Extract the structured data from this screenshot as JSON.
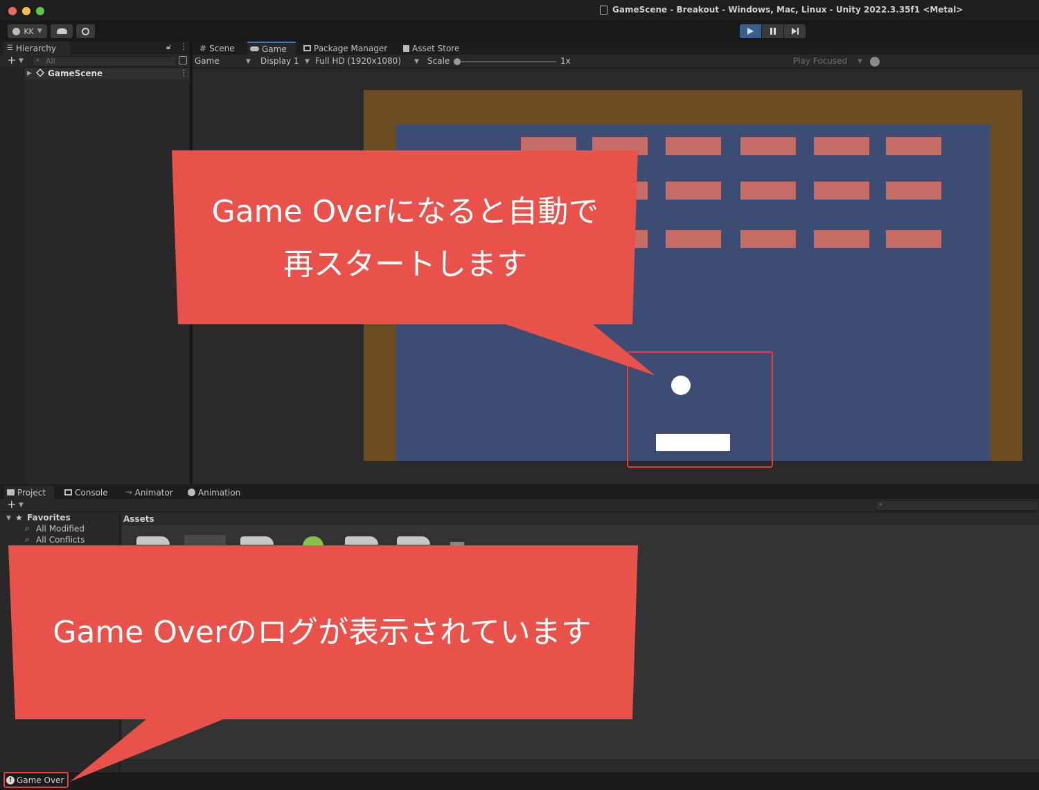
{
  "window": {
    "title": "GameScene - Breakout - Windows, Mac, Linux - Unity 2022.3.35f1 <Metal>"
  },
  "toolbar": {
    "account_label": "KK"
  },
  "hierarchy": {
    "tab_label": "Hierarchy",
    "search_placeholder": "All",
    "scene_name": "GameScene"
  },
  "game_view": {
    "tabs": [
      "Scene",
      "Game",
      "Package Manager",
      "Asset Store"
    ],
    "mode_select": "Game",
    "display_select": "Display 1",
    "resolution_select": "Full HD (1920x1080)",
    "scale_label": "Scale",
    "scale_value": "1x",
    "play_mode_select": "Play Focused",
    "brick_rows": [
      6,
      5,
      5
    ]
  },
  "bottom_panel": {
    "tabs": [
      "Project",
      "Console",
      "Animator",
      "Animation"
    ],
    "favorites_label": "Favorites",
    "favorites_items": [
      "All Modified",
      "All Conflicts"
    ],
    "assets_header": "Assets"
  },
  "status_bar": {
    "message": "Game Over"
  },
  "callouts": {
    "top_line1": "Game Overになると自動で",
    "top_line2": "再スタートします",
    "bottom": "Game Overのログが表示されています"
  },
  "colors": {
    "callout": "#e8524a",
    "highlight": "#e0403a",
    "field": "#3d4c72",
    "border": "#6c4d22",
    "brick": "#c76c64"
  }
}
